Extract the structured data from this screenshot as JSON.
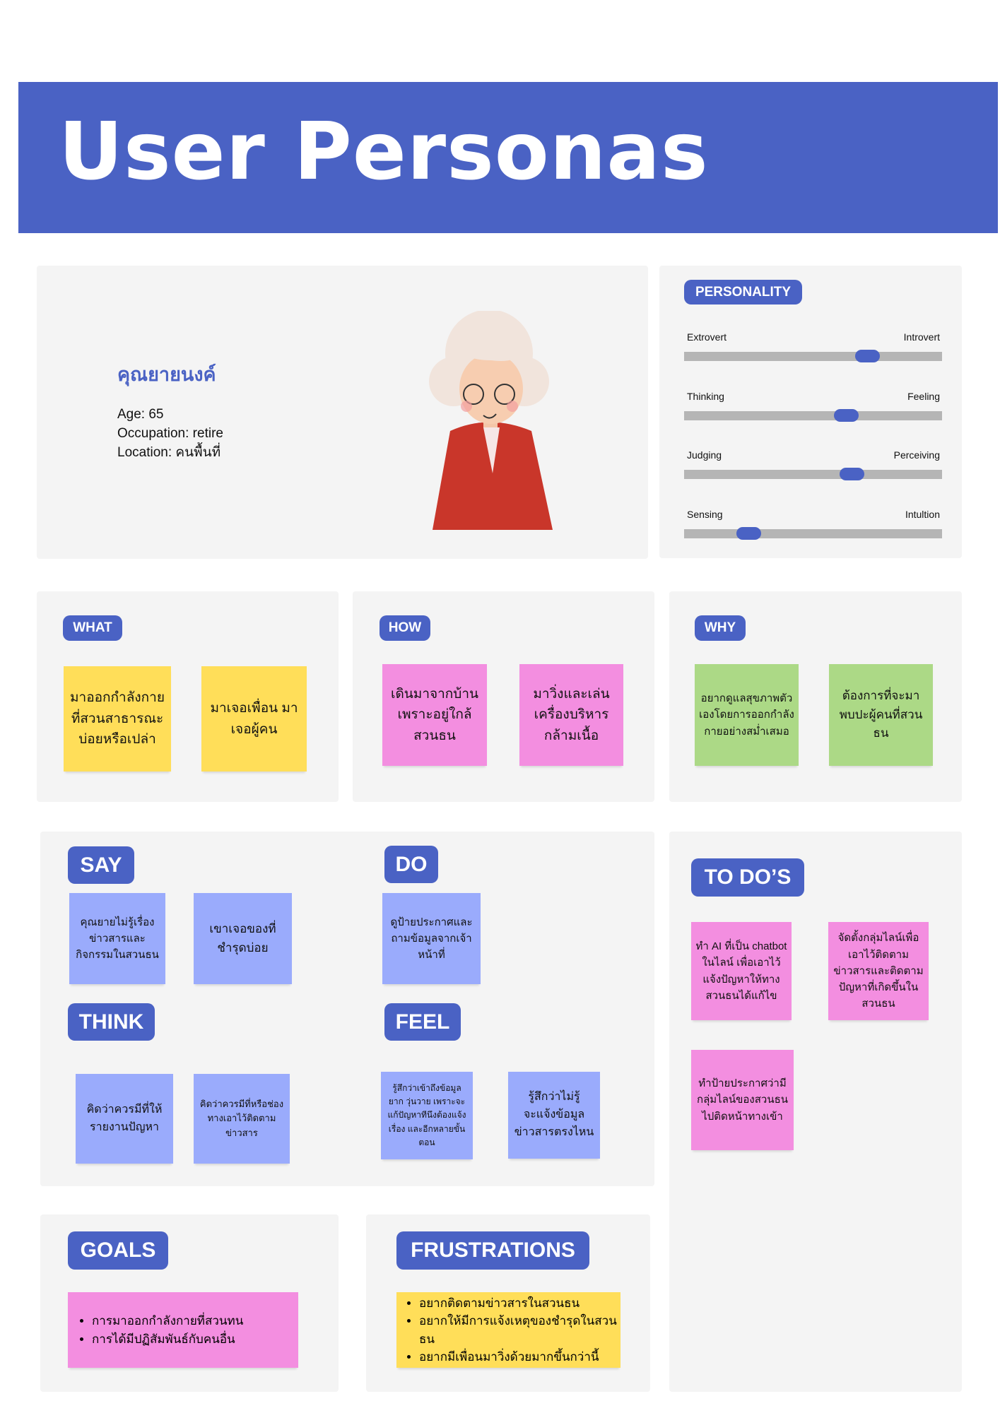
{
  "header": {
    "title": "User Personas"
  },
  "persona": {
    "name": "คุณยายนงค์",
    "age": "Age: 65",
    "occupation": "Occupation: retire",
    "location": "Location: คนพื้นที่"
  },
  "personality": {
    "label": "PERSONALITY",
    "traits": [
      {
        "left": "Extrovert",
        "right": "Introvert",
        "value": 0.71
      },
      {
        "left": "Thinking",
        "right": "Feeling",
        "value": 0.63
      },
      {
        "left": "Judging",
        "right": "Perceiving",
        "value": 0.65
      },
      {
        "left": "Sensing",
        "right": "Intultion",
        "value": 0.25
      }
    ]
  },
  "what": {
    "label": "WHAT",
    "notes": [
      "มาออกกำลังกายที่สวนสาธารณะบ่อยหรือเปล่า",
      "มาเจอเพื่อน มาเจอผู้คน"
    ]
  },
  "how": {
    "label": "HOW",
    "notes": [
      "เดินมาจากบ้านเพราะอยู่ใกล้สวนธน",
      "มาวิ่งและเล่นเครื่องบริหารกล้ามเนื้อ"
    ]
  },
  "why": {
    "label": "WHY",
    "notes": [
      "อยากดูแลสุขภาพตัวเองโดยการออกกำลังกายอย่างสม่ำเสมอ",
      "ต้องการที่จะมาพบปะผู้คนที่สวนธน"
    ]
  },
  "say": {
    "label": "SAY",
    "notes": [
      "คุณยายไม่รู้เรื่องข่าวสารและกิจกรรมในสวนธน",
      "เขาเจอของที่ชำรุดบ่อย"
    ]
  },
  "do": {
    "label": "DO",
    "notes": [
      "ดูป้ายประกาศและถามข้อมูลจากเจ้าหน้าที่"
    ]
  },
  "think": {
    "label": "THINK",
    "notes": [
      "คิดว่าควรมีที่ให้รายงานปัญหา",
      "คิดว่าควรมีที่หรือช่องทางเอาไว้ติดตามข่าวสาร"
    ]
  },
  "feel": {
    "label": "FEEL",
    "notes": [
      "รู้สึกว่าเข้าถึงข้อมูลยาก วุ่นวาย เพราะจะแก้ปัญหาทีนึงต้องแจ้งเรื่อง และอีกหลายขั้นตอน",
      "รู้สึกว่าไม่รู้จะแจ้งข้อมูลข่าวสารตรงไหน"
    ]
  },
  "todo": {
    "label": "TO DO’S",
    "notes": [
      "ทำ AI ที่เป็น chatbot ในไลน์ เพื่อเอาไว้แจ้งปัญหาให้ทางสวนธนได้แก้ไข",
      "จัดตั้งกลุ่มไลน์เพื่อเอาไว้ติดตามข่าวสารและติดตามปัญหาที่เกิดขึ้นในสวนธน",
      "ทำป้ายประกาศว่ามีกลุ่มไลน์ของสวนธนไปติดหน้าทางเข้า"
    ]
  },
  "goals": {
    "label": "GOALS",
    "items": [
      "การมาออกกำลังกายที่สวนทน",
      "การได้มีปฏิสัมพันธ์กับคนอื่น"
    ]
  },
  "frustrations": {
    "label": "FRUSTRATIONS",
    "items": [
      "อยากติดตามข่าวสารในสวนธน",
      "อยากให้มีการแจ้งเหตุของชำรุดในสวนธน",
      "อยากมีเพื่อนมาวิ่งด้วยมากขึ้นกว่านี้"
    ]
  },
  "colors": {
    "accent": "#4a62c4",
    "yellow": "#ffde59",
    "pink": "#f38ee0",
    "green": "#acd986",
    "lavender": "#9aabfc",
    "card": "#f4f4f4"
  }
}
